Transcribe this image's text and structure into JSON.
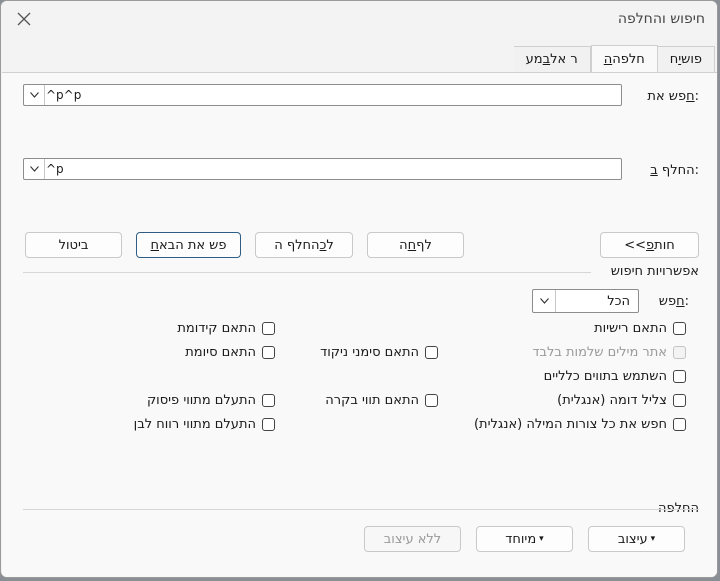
{
  "window": {
    "title": "חיפוש והחלפה"
  },
  "tabs": [
    {
      "pre": "ח",
      "u": "י",
      "post": "פוש"
    },
    {
      "pre": "",
      "u": "ה",
      "post": "חלפה"
    },
    {
      "pre": "מע",
      "u": "ב",
      "post": "ר אל"
    }
  ],
  "find": {
    "label_pre": "",
    "label_u": "ח",
    "label_post": "פש את:",
    "value": "^p^p"
  },
  "replace": {
    "label_pre": "החלף ",
    "label_u": "ב",
    "label_post": ":",
    "value": "^p"
  },
  "buttons": {
    "less_pre": "<< ",
    "less_u": "פ",
    "less_post": "חות",
    "replace_pre": "ה",
    "replace_u": "ח",
    "replace_post": "לף",
    "replace_all_pre": "החלף ה",
    "replace_all_u": "כ",
    "replace_all_post": "ל",
    "find_next_pre": "",
    "find_next_u": "ח",
    "find_next_post": "פש את הבא",
    "cancel": "ביטול"
  },
  "options": {
    "section_label": "אפשרויות חיפוש",
    "search_label_pre": "",
    "search_label_u": "ח",
    "search_label_post": "פש:",
    "search_scope": "הכל",
    "match_case": "התאם רישיות",
    "whole_words": "אתר מילים שלמות בלבד",
    "wildcards": "השתמש בתווים כלליים",
    "sounds_like": "צליל דומה (אנגלית)",
    "word_forms": "חפש את כל צורות המילה (אנגלית)",
    "match_prefix": "התאם קידומת",
    "match_suffix": "התאם סיומת",
    "match_diacritics": "התאם סימני ניקוד",
    "match_kashida": "התאם תווי בקרה",
    "ignore_punct": "התעלם מתווי פיסוק",
    "ignore_space": "התעלם מתווי רווח לבן"
  },
  "replace_section": {
    "label": "החלפה",
    "format": "עיצוב",
    "special": "מיוחד",
    "no_formatting": "ללא עיצוב"
  }
}
